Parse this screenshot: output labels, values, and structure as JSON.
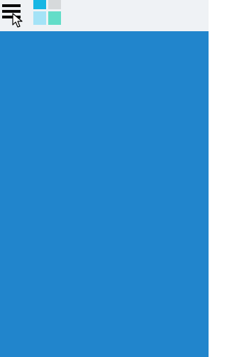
{
  "app": {
    "content_background": "#2185cc",
    "topbar_background": "#eff2f5"
  },
  "menu": {
    "icon": "hamburger-menu-icon",
    "color": "#0b0b0b"
  },
  "logo": {
    "icon": "app-logo-grid-icon",
    "tile_colors": {
      "top_left": "#16b6e4",
      "top_right": "#d6d9db",
      "bottom_left": "#a4e3f7",
      "bottom_right": "#63ddc8"
    }
  },
  "cursor": {
    "icon": "mouse-pointer-cursor-icon"
  }
}
